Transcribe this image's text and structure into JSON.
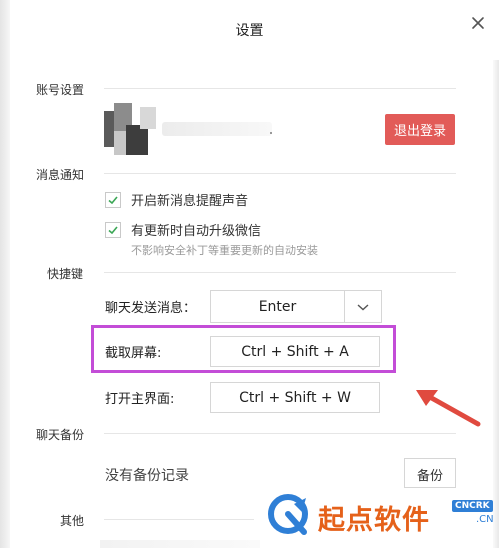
{
  "window": {
    "title": "设置",
    "close_icon": "close-icon"
  },
  "sections": {
    "account": "账号设置",
    "notifications": "消息通知",
    "shortcuts": "快捷键",
    "backup": "聊天备份",
    "other": "其他"
  },
  "account": {
    "logout_label": "退出登录",
    "logout_color": "#e25b58"
  },
  "notifications": {
    "items": [
      {
        "label": "开启新消息提醒声音",
        "checked": true
      },
      {
        "label": "有更新时自动升级微信",
        "checked": true
      }
    ],
    "hint": "不影响安全补丁等重要更新的自动安装"
  },
  "shortcuts": {
    "send_message": {
      "label": "聊天发送消息：",
      "value": "Enter"
    },
    "screenshot": {
      "label": "截取屏幕:",
      "value": "Ctrl + Shift + A"
    },
    "open_main": {
      "label": "打开主界面:",
      "value": "Ctrl + Shift + W"
    }
  },
  "backup": {
    "status": "没有备份记录",
    "button_label": "备份"
  },
  "watermark": {
    "brand": "起点软件",
    "badge": "CNCRK",
    "suffix": ".CN"
  },
  "colors": {
    "highlight": "#c34dd7",
    "arrow": "#e04a3f",
    "check": "#3aa655"
  }
}
